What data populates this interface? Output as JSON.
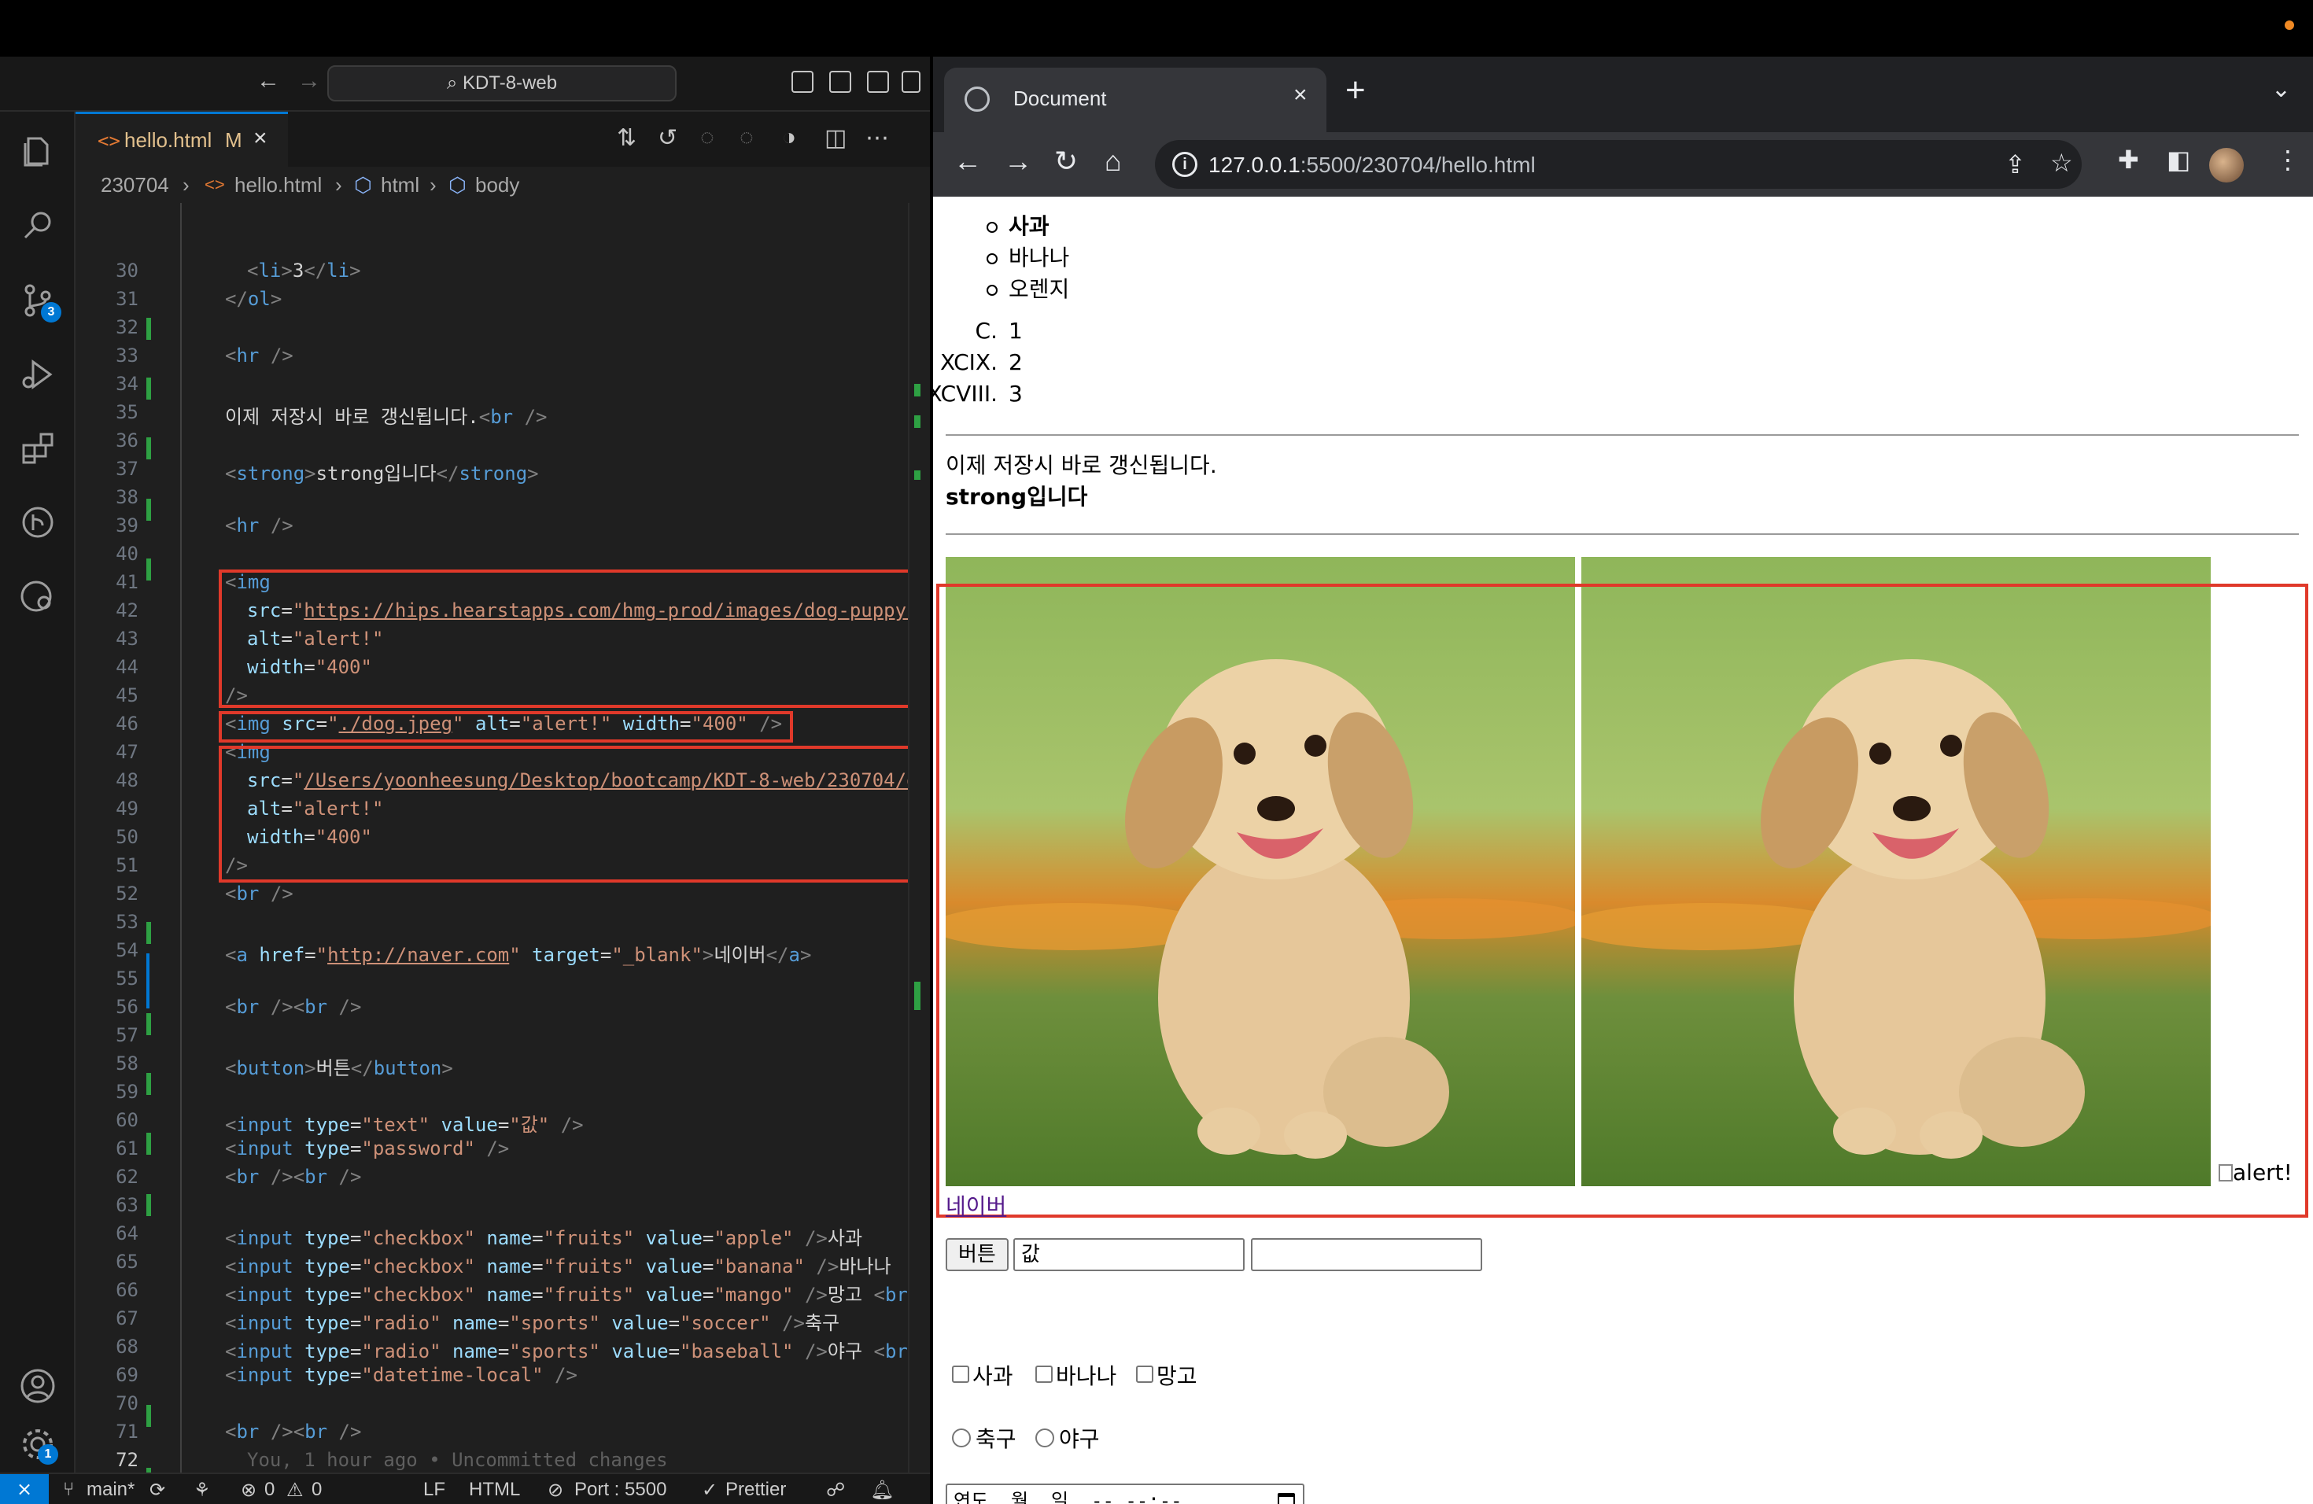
{
  "vscode": {
    "command_center": "KDT-8-web",
    "tab": {
      "filename": "hello.html",
      "status": "M"
    },
    "breadcrumb": [
      "230704",
      "hello.html",
      "html",
      "body"
    ],
    "badges": {
      "scm": "3",
      "settings": "1"
    },
    "blame_line": "You, 1 hour ago • Uncommitted changes",
    "status": {
      "branch": "main*",
      "errors": "0",
      "warnings": "0",
      "eol": "LF",
      "language": "HTML",
      "port": "Port : 5500",
      "formatter": "Prettier"
    }
  },
  "chrome": {
    "tab_title": "Document",
    "url_host": "127.0.0.1",
    "url_rest": ":5500/230704/hello.html"
  },
  "page": {
    "ul_items": [
      "사과",
      "바나나",
      "오렌지"
    ],
    "ol_items": [
      {
        "marker": "C.",
        "text": "1"
      },
      {
        "marker": "XCIX.",
        "text": "2"
      },
      {
        "marker": "XCVIII.",
        "text": "3"
      }
    ],
    "refresh_text": "이제 저장시 바로 갱신됩니다.",
    "strong_text": "strong입니다",
    "broken_img_alt": "alert!",
    "link_text": "네이버",
    "button_label": "버튼",
    "text_input_value": "값",
    "checkbox_labels": [
      "사과",
      "바나나",
      "망고"
    ],
    "radio_labels": [
      "축구",
      "야구"
    ],
    "datetime_placeholder": "연도. 월. 일. -- --:--"
  },
  "colors": {
    "highlight": "#e0392a",
    "accent": "#0078d4",
    "git_added": "#2ea043"
  }
}
